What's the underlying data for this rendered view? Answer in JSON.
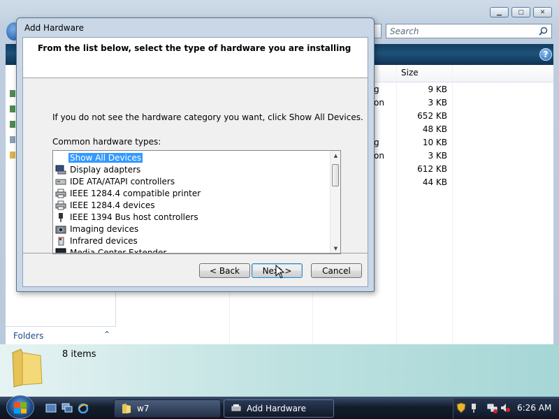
{
  "explorer": {
    "search_placeholder": "Search",
    "size_header": "Size",
    "rows": [
      {
        "frag": "g",
        "size": "9 KB"
      },
      {
        "frag": "on",
        "size": "3 KB"
      },
      {
        "frag": "",
        "size": "652 KB"
      },
      {
        "frag": "",
        "size": "48 KB"
      },
      {
        "frag": "g",
        "size": "10 KB"
      },
      {
        "frag": "on",
        "size": "3 KB"
      },
      {
        "frag": "",
        "size": "612 KB"
      },
      {
        "frag": "",
        "size": "44 KB"
      }
    ],
    "folders_label": "Folders",
    "item_count": "8 items"
  },
  "dialog": {
    "title": "Add Hardware",
    "header": "From the list below, select the type of hardware you are installing",
    "hint": "If you do not see the hardware category you want, click Show All Devices.",
    "list_label": "Common hardware types:",
    "items": [
      {
        "label": "Show All Devices",
        "selected": true,
        "icon": "all-devices-icon"
      },
      {
        "label": "Display adapters",
        "icon": "display-adapter-icon"
      },
      {
        "label": "IDE ATA/ATAPI controllers",
        "icon": "ide-controller-icon"
      },
      {
        "label": "IEEE 1284.4 compatible printer",
        "icon": "printer-icon"
      },
      {
        "label": "IEEE 1284.4 devices",
        "icon": "printer-icon"
      },
      {
        "label": "IEEE 1394 Bus host controllers",
        "icon": "firewire-icon"
      },
      {
        "label": "Imaging devices",
        "icon": "camera-icon"
      },
      {
        "label": "Infrared devices",
        "icon": "infrared-icon"
      },
      {
        "label": "Media Center Extender",
        "icon": "media-extender-icon"
      }
    ],
    "back_label": "< Back",
    "next_label": "Next >",
    "cancel_label": "Cancel"
  },
  "taskbar": {
    "tasks": [
      {
        "label": "w7",
        "active": false
      },
      {
        "label": "Add Hardware",
        "active": true
      }
    ],
    "clock": "6:26 AM"
  },
  "colors": {
    "selection": "#3399ff",
    "toolbar": "#1e5178",
    "details_pane": "#bfe2e1"
  }
}
